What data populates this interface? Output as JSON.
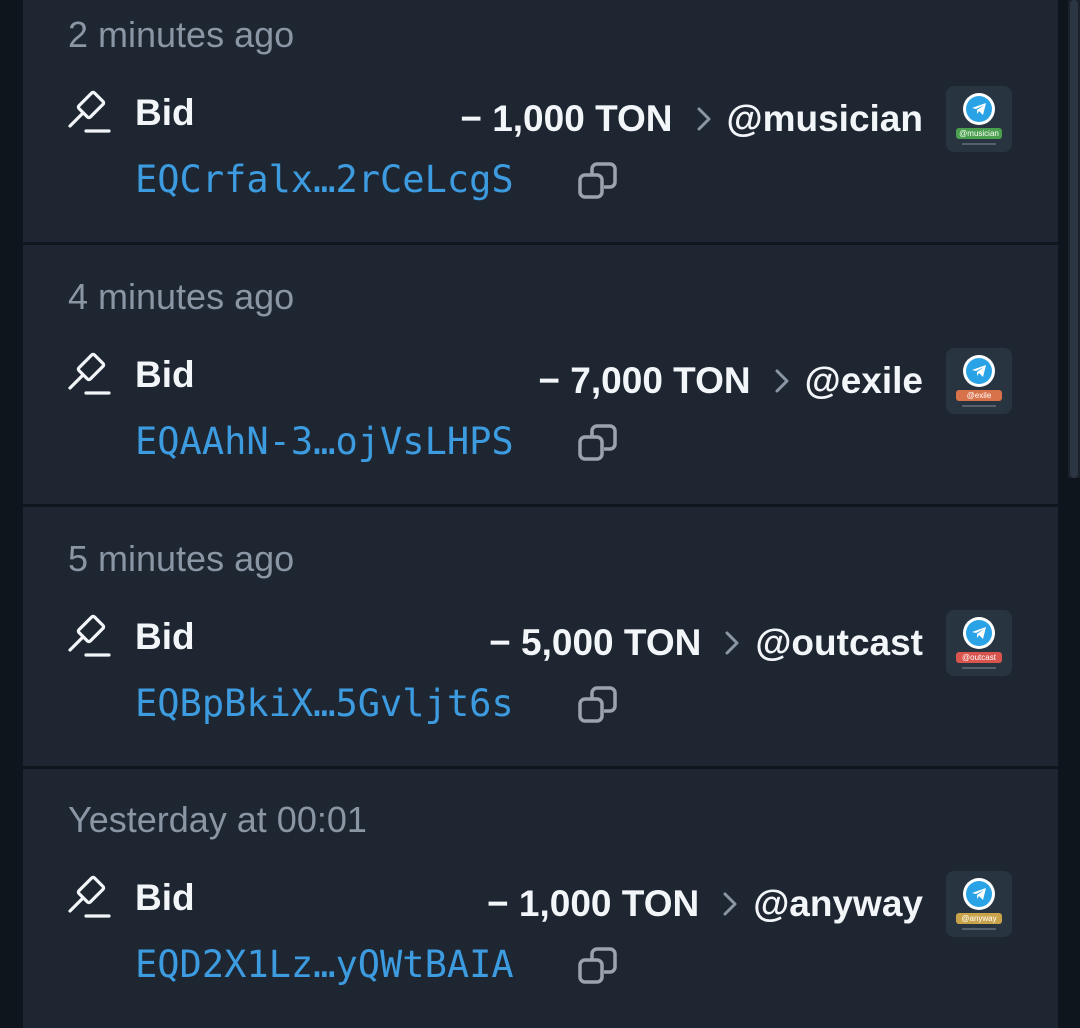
{
  "transactions": [
    {
      "time": "2 minutes ago",
      "type": "Bid",
      "amount": "− 1,000 TON",
      "username": "@musician",
      "address": "EQCrfalx…2rCeLcgS",
      "thumb_tag": "@musician",
      "tag_color": "#4aa04e"
    },
    {
      "time": "4 minutes ago",
      "type": "Bid",
      "amount": "− 7,000 TON",
      "username": "@exile",
      "address": "EQAAhN-3…ojVsLHPS",
      "thumb_tag": "@exile",
      "tag_color": "#d8724a"
    },
    {
      "time": "5 minutes ago",
      "type": "Bid",
      "amount": "− 5,000 TON",
      "username": "@outcast",
      "address": "EQBpBkiX…5Gvljt6s",
      "thumb_tag": "@outcast",
      "tag_color": "#d9544d"
    },
    {
      "time": "Yesterday at 00:01",
      "type": "Bid",
      "amount": "− 1,000 TON",
      "username": "@anyway",
      "address": "EQD2X1Lz…yQWtBAIA",
      "thumb_tag": "@anyway",
      "tag_color": "#c9a34a"
    }
  ],
  "icons": {
    "type_icon": "gavel-icon",
    "separator_icon": "chevron-right-icon",
    "copy_icon": "copy-icon",
    "thumb_icon": "telegram-icon"
  },
  "colors": {
    "background": "#1e2632",
    "address_link": "#3d9be0",
    "muted_text": "#8b96a4"
  }
}
